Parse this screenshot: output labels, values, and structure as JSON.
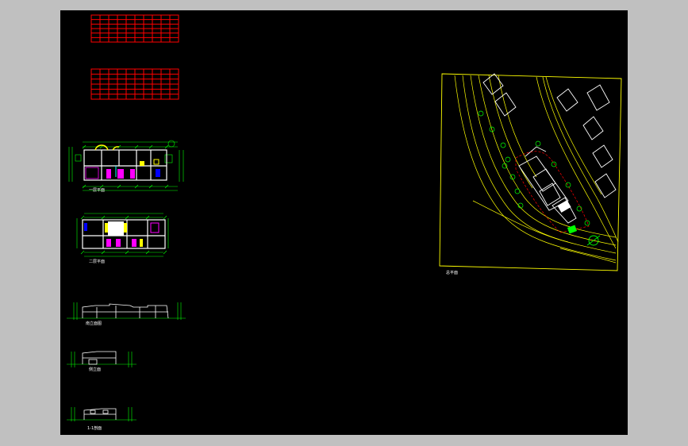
{
  "drawing": {
    "background": "#000000",
    "frame_color": "#c0c0c0",
    "colors": {
      "table": "#ff0000",
      "dimension": "#00ff00",
      "wall": "#ffffff",
      "accent_yellow": "#ffff00",
      "accent_magenta": "#ff00ff",
      "accent_cyan": "#00ffff",
      "accent_blue": "#0000ff",
      "site_contour": "#ffff00",
      "site_building": "#ffffff",
      "tree": "#00ff00",
      "site_boundary": "#ff0000"
    },
    "sheets": {
      "table_top": {
        "rows": 6,
        "cols": 10
      },
      "table_bottom": {
        "rows": 6,
        "cols": 10
      },
      "plan_ground_label": "一层平面",
      "plan_upper_label": "二层平面",
      "elevation_front_label": "南立面图",
      "elevation_side_label": "侧立面",
      "elevation_rear_label": "1-1剖面",
      "site_plan_label": "总平面"
    }
  }
}
